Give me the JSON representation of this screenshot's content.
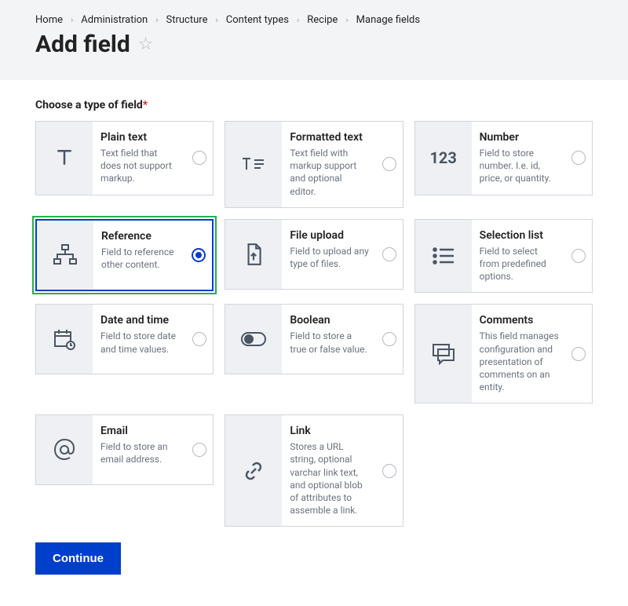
{
  "breadcrumb": {
    "items": [
      {
        "label": "Home"
      },
      {
        "label": "Administration"
      },
      {
        "label": "Structure"
      },
      {
        "label": "Content types"
      },
      {
        "label": "Recipe"
      },
      {
        "label": "Manage fields"
      }
    ]
  },
  "page": {
    "title": "Add field"
  },
  "section_label": "Choose a type of field",
  "required_marker": "*",
  "fields": {
    "plain_text": {
      "title": "Plain text",
      "desc": "Text field that does not support markup."
    },
    "formatted_text": {
      "title": "Formatted text",
      "desc": "Text field with markup support and optional editor."
    },
    "number": {
      "title": "Number",
      "desc": "Field to store number. I.e. id, price, or quantity."
    },
    "reference": {
      "title": "Reference",
      "desc": "Field to reference other content."
    },
    "file_upload": {
      "title": "File upload",
      "desc": "Field to upload any type of files."
    },
    "selection_list": {
      "title": "Selection list",
      "desc": "Field to select from predefined options."
    },
    "date_time": {
      "title": "Date and time",
      "desc": "Field to store date and time values."
    },
    "boolean": {
      "title": "Boolean",
      "desc": "Field to store a true or false value."
    },
    "comments": {
      "title": "Comments",
      "desc": "This field manages configuration and presentation of comments on an entity."
    },
    "email": {
      "title": "Email",
      "desc": "Field to store an email address."
    },
    "link": {
      "title": "Link",
      "desc": "Stores a URL string, optional varchar link text, and optional blob of attributes to assemble a link."
    }
  },
  "selected": "reference",
  "actions": {
    "continue_label": "Continue"
  },
  "number_icon_text": "123"
}
